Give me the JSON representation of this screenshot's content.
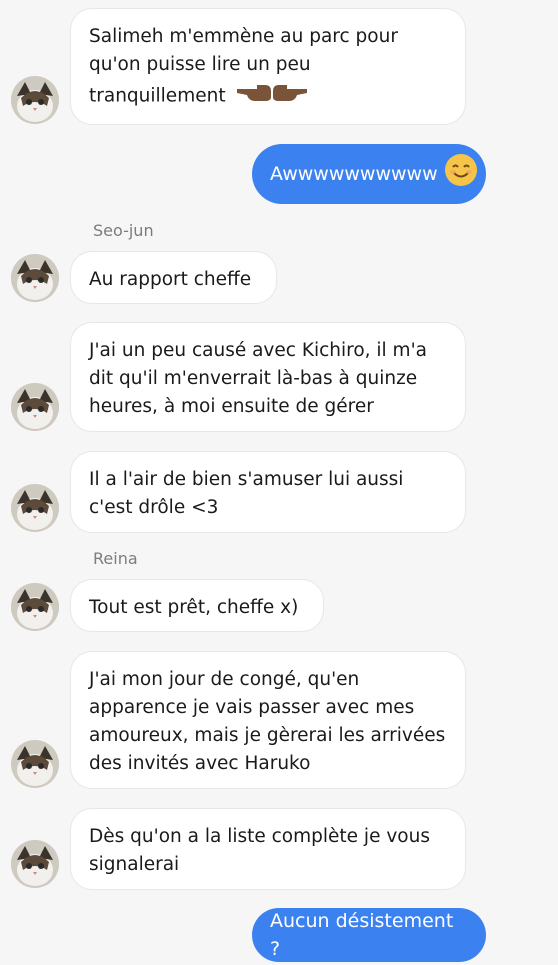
{
  "messages": [
    {
      "type": "in",
      "text": "Salimeh m'emmène au parc pour qu'on puisse lire un peu tranquillement",
      "emoji": "pointing-hands-icon"
    },
    {
      "type": "out",
      "text": "Awwwwwwwwww",
      "emoji": "smiling-face-icon"
    },
    {
      "type": "sender",
      "name": "Seo-jun"
    },
    {
      "type": "in",
      "text": "Au rapport cheffe"
    },
    {
      "type": "in",
      "text": "J'ai un peu causé avec Kichiro, il m'a dit qu'il m'enverrait là-bas à quinze heures, à moi ensuite de gérer"
    },
    {
      "type": "in",
      "text": "Il a l'air de bien s'amuser lui aussi c'est drôle <3"
    },
    {
      "type": "sender",
      "name": "Reina"
    },
    {
      "type": "in",
      "text": "Tout est prêt, cheffe x)"
    },
    {
      "type": "in",
      "text": "J'ai mon jour de congé, qu'en apparence je vais passer avec mes amoureux, mais je gèrerai les arrivées des invités avec Haruko"
    },
    {
      "type": "in",
      "text": "Dès qu'on a la liste complète je vous signalerai"
    },
    {
      "type": "out",
      "text": "Aucun désistement ?"
    }
  ],
  "colors": {
    "outgoing": "#3b82f0",
    "incoming": "#ffffff",
    "background": "#f6f6f6"
  }
}
